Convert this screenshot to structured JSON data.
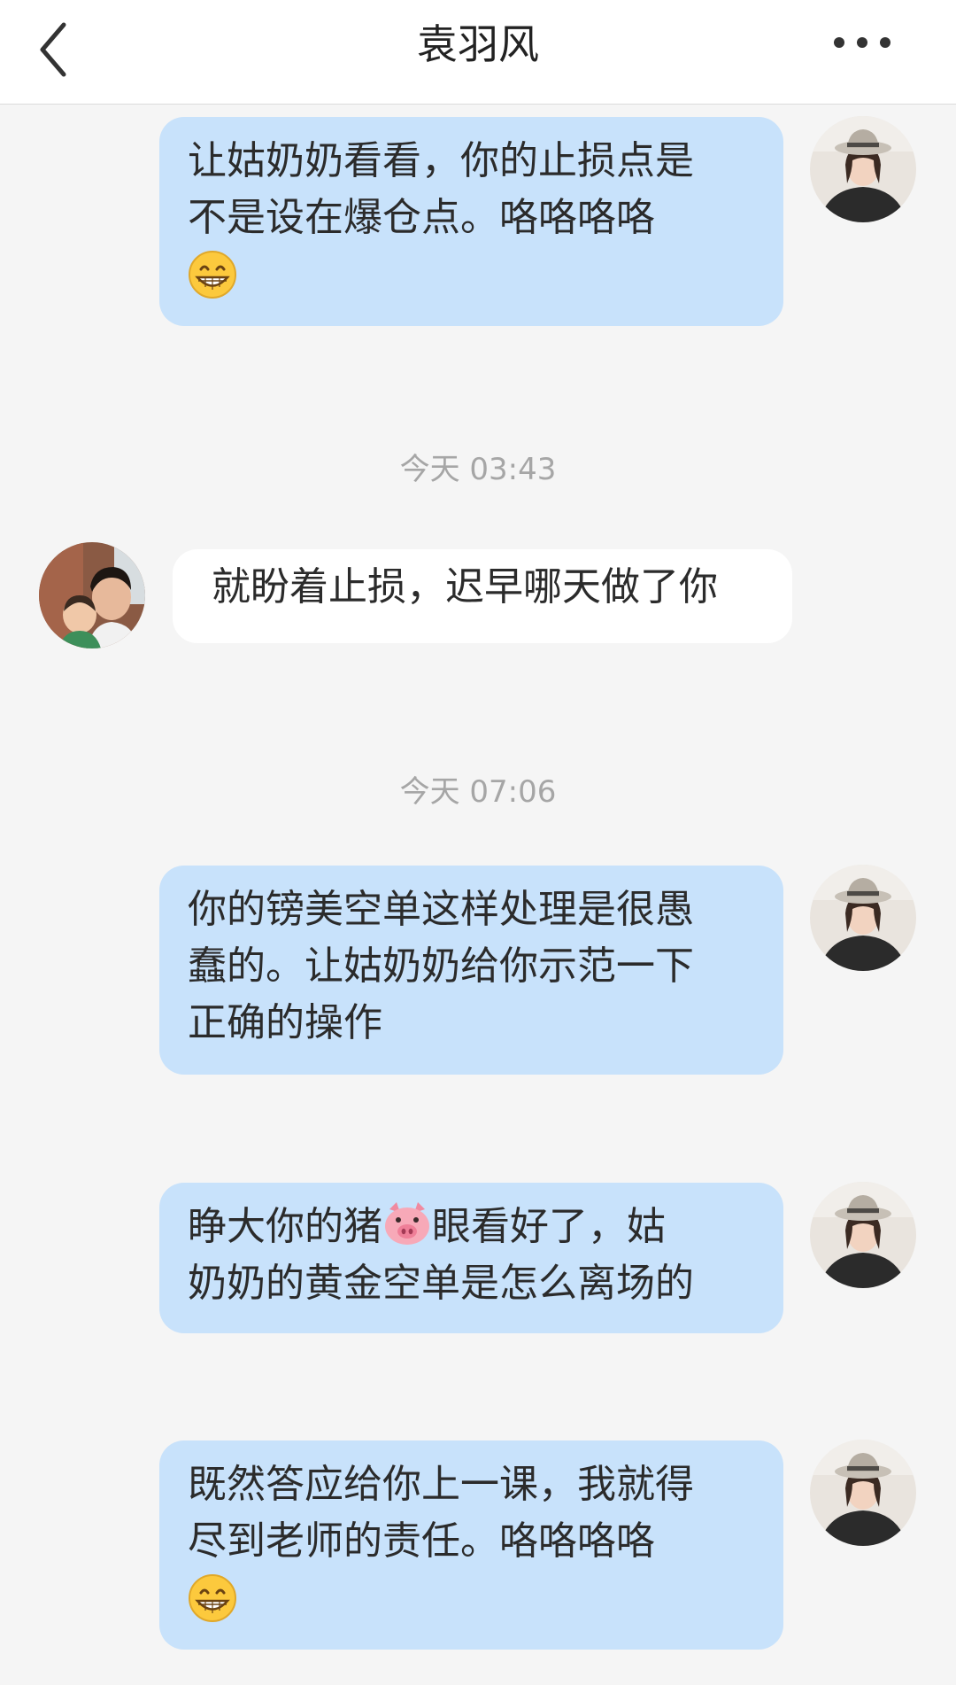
{
  "header": {
    "title": "袁羽风",
    "back_icon": "chevron-left-icon",
    "more_icon": "more-dots-icon"
  },
  "messages": [
    {
      "sender": "self",
      "lines": [
        "让姑奶奶看看，你的止损点是",
        "不是设在爆仓点。咯咯咯咯"
      ],
      "emoji": "grinning-face-emoji"
    },
    {
      "timestamp": "今天 03:43"
    },
    {
      "sender": "other",
      "text": "就盼着止损，迟早哪天做了你"
    },
    {
      "timestamp": "今天 07:06"
    },
    {
      "sender": "self",
      "lines": [
        "你的镑美空单这样处理是很愚",
        "蠢的。让姑奶奶给你示范一下",
        "正确的操作"
      ]
    },
    {
      "sender": "self",
      "line1_before": "睁大你的猪",
      "inline_emoji": "pig-face-emoji",
      "line1_after": "眼看好了，姑",
      "line2": "奶奶的黄金空单是怎么离场的"
    },
    {
      "sender": "self",
      "lines": [
        "既然答应给你上一课，我就得",
        "尽到老师的责任。咯咯咯咯"
      ],
      "emoji": "grinning-face-emoji"
    }
  ],
  "colors": {
    "background": "#f5f5f5",
    "self_bubble": "#c8e2fb",
    "other_bubble": "#ffffff",
    "timestamp": "#a6a6a6"
  }
}
